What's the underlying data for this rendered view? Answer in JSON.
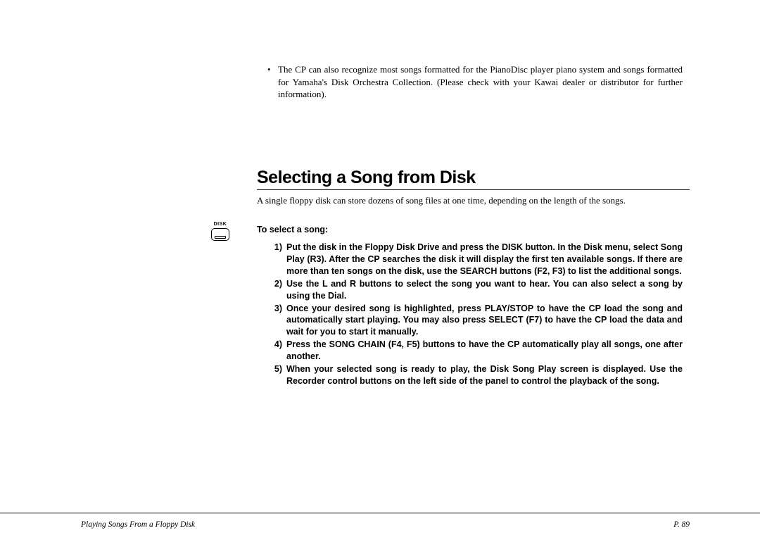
{
  "topBullet": {
    "text": "The CP can also recognize most songs formatted for the PianoDisc player piano system and songs formatted for Yamaha's Disk Orchestra Collection. (Please check with your Kawai dealer or distributor for further information)."
  },
  "heading": "Selecting a Song from Disk",
  "intro": "A single floppy disk can store dozens of song files at one time, depending on the length of the songs.",
  "subheading": "To select a song:",
  "diskLabel": "DISK",
  "steps": [
    {
      "num": "1)",
      "text": "Put the disk in the Floppy Disk Drive and press the DISK button.  In the Disk menu, select Song Play (R3).  After the CP searches the disk it will display the first ten available songs.  If there are more than ten songs on the disk, use the SEARCH buttons (F2, F3) to list the additional songs."
    },
    {
      "num": "2)",
      "text": "Use the L and R buttons to select the song you want to hear.  You can also select a song by using the Dial."
    },
    {
      "num": "3)",
      "text": "Once your desired song is highlighted, press PLAY/STOP to have the CP load the song and automatically start playing.  You may also press SELECT (F7) to have the CP load the data and wait for you to start it manually."
    },
    {
      "num": "4)",
      "text": "Press the SONG CHAIN (F4, F5) buttons to have the CP automatically play all songs, one after another."
    },
    {
      "num": "5)",
      "text": "When your selected song is ready to play, the Disk Song Play screen is displayed.  Use the Recorder control buttons on the left side of the panel to control the playback of the song."
    }
  ],
  "footer": {
    "left": "Playing Songs From a Floppy Disk",
    "right": "P. 89"
  }
}
